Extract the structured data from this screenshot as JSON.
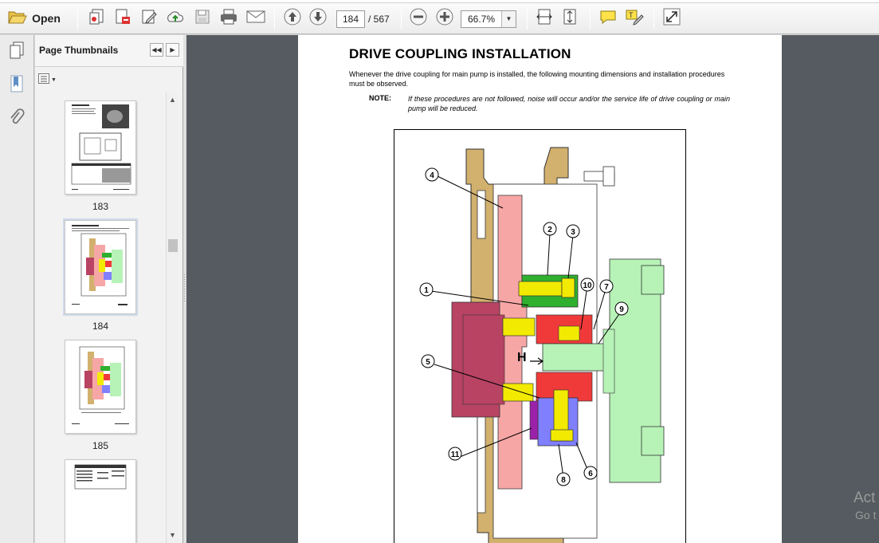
{
  "toolbar": {
    "open_label": "Open",
    "current_page": "184",
    "total_pages": "/ 567",
    "zoom": "66.7%",
    "icons": [
      "folder-open-icon",
      "create-pdf-icon",
      "edit-pdf-icon",
      "sign-icon",
      "upload-cloud-icon",
      "save-icon",
      "print-icon",
      "email-icon",
      "previous-page-icon",
      "next-page-icon",
      "zoom-out-icon",
      "zoom-in-icon",
      "fit-width-icon",
      "fit-page-icon",
      "comment-icon",
      "highlight-text-icon",
      "fullscreen-icon"
    ]
  },
  "sidebar": {
    "panel_title": "Page Thumbnails",
    "thumbnails": [
      {
        "label": "183"
      },
      {
        "label": "184"
      },
      {
        "label": "185"
      },
      {
        "label": ""
      }
    ]
  },
  "document": {
    "title": "DRIVE COUPLING INSTALLATION",
    "paragraph": "Whenever the drive coupling for main pump is installed, the following mounting dimensions and installation procedures must be observed.",
    "note_label": "NOTE:",
    "note_text": "If these procedures are not followed, noise will occur and/or the service life of drive coupling or main pump will be reduced.",
    "figure": {
      "callouts": [
        "4",
        "2",
        "3",
        "1",
        "10",
        "7",
        "9",
        "5",
        "H",
        "11",
        "8",
        "6"
      ],
      "colors": {
        "housing": "#d2b06e",
        "flywheel": "#f7a6a6",
        "hub": "#b84363",
        "green_part": "#2fb02f",
        "yellow_part": "#f2ea00",
        "red_part": "#f03a3a",
        "blue_part": "#8080ff",
        "light_green": "#b7f2b7",
        "purple_part": "#9a22a8"
      }
    }
  },
  "watermark": {
    "line1": "Act",
    "line2": "Go t"
  }
}
